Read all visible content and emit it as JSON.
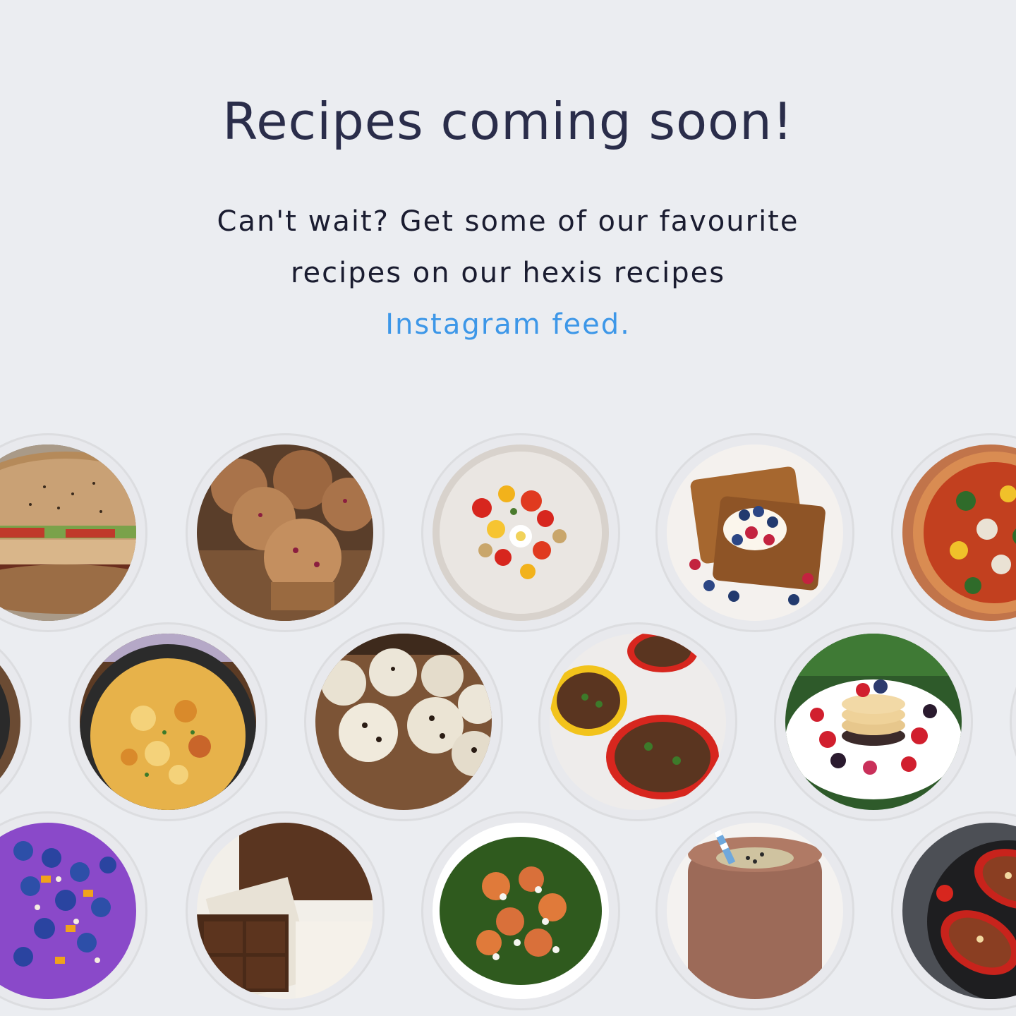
{
  "hero": {
    "title": "Recipes coming soon!",
    "subtitle_line1": "Can't wait? Get some of our favourite",
    "subtitle_line2": "recipes on our hexis recipes",
    "link_text": "Instagram feed."
  },
  "colors": {
    "background": "#ebedf1",
    "title": "#2a2d4a",
    "body_text": "#1a1c30",
    "link": "#3d97e8"
  },
  "gallery": {
    "items": [
      {
        "name": "burger",
        "icon": "burger-photo"
      },
      {
        "name": "muffins",
        "icon": "muffins-photo"
      },
      {
        "name": "tomato-salad",
        "icon": "salad-photo"
      },
      {
        "name": "french-toast",
        "icon": "french-toast-photo"
      },
      {
        "name": "pizza",
        "icon": "pizza-photo"
      },
      {
        "name": "pancakes-partial-left",
        "icon": "food-photo"
      },
      {
        "name": "egg-bake",
        "icon": "skillet-photo"
      },
      {
        "name": "energy-balls",
        "icon": "energy-balls-photo"
      },
      {
        "name": "stuffed-peppers",
        "icon": "stuffed-peppers-photo"
      },
      {
        "name": "pancake-stack",
        "icon": "pancakes-photo"
      },
      {
        "name": "partial-right",
        "icon": "food-photo"
      },
      {
        "name": "smoothie-bowl",
        "icon": "smoothie-bowl-photo"
      },
      {
        "name": "brownies",
        "icon": "brownies-photo"
      },
      {
        "name": "chicken-salad",
        "icon": "salad-photo"
      },
      {
        "name": "chocolate-smoothie",
        "icon": "smoothie-photo"
      },
      {
        "name": "skillet-peppers",
        "icon": "skillet-photo"
      }
    ]
  }
}
